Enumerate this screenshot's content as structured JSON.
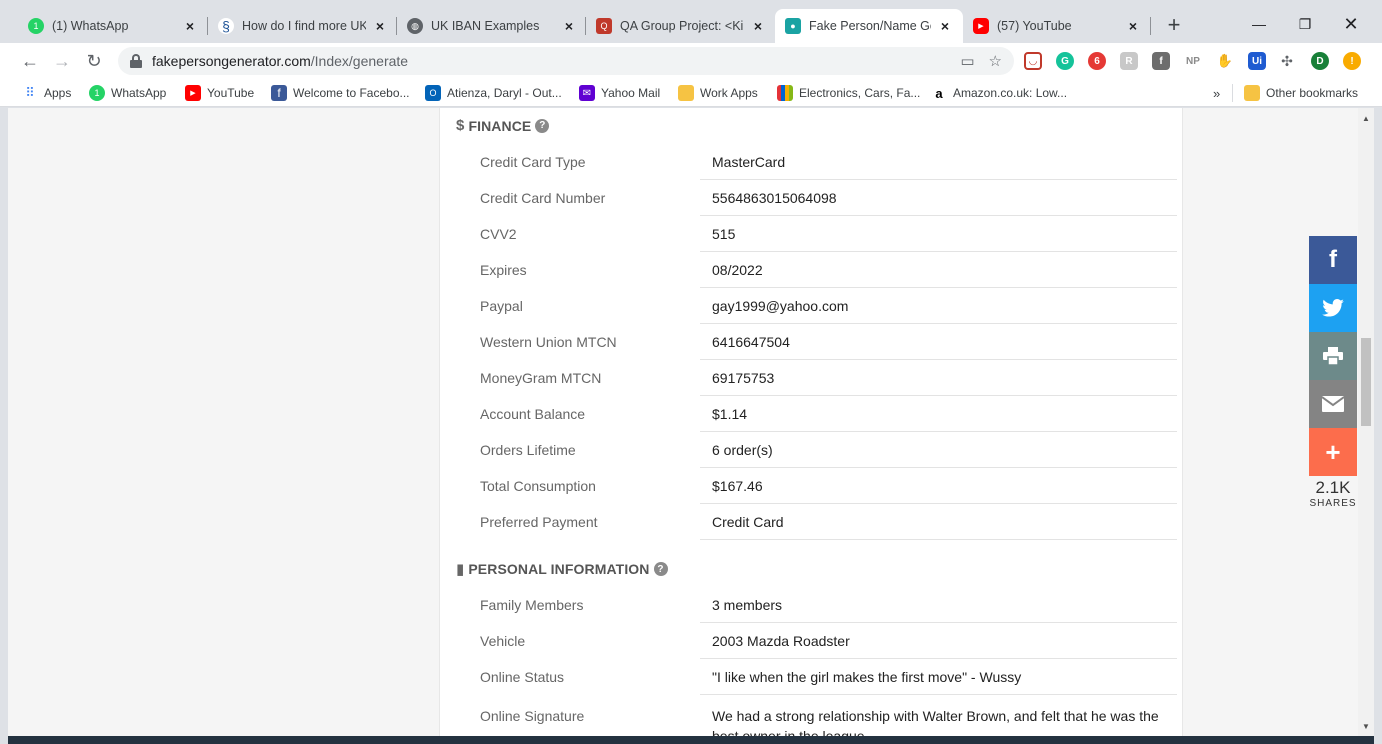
{
  "tabs": [
    {
      "title": "(1) WhatsApp",
      "icon": "whatsapp-icon",
      "color": "#25d366",
      "badge": "1"
    },
    {
      "title": "How do I find more UK",
      "icon": "stackexchange-icon",
      "color": "#1e5397",
      "badge": ""
    },
    {
      "title": "UK IBAN Examples",
      "icon": "globe-icon",
      "color": "#5f6368",
      "badge": ""
    },
    {
      "title": "QA Group Project: <Kin",
      "icon": "qa-icon",
      "color": "#c0392b",
      "badge": ""
    },
    {
      "title": "Fake Person/Name Gen",
      "icon": "person-icon",
      "color": "#1aa3a3",
      "badge": ""
    },
    {
      "title": "(57) YouTube",
      "icon": "youtube-icon",
      "color": "#ff0000",
      "badge": ""
    }
  ],
  "address_bar": {
    "host": "fakepersongenerator.com",
    "path": "/Index/generate"
  },
  "bookmarks": [
    {
      "label": "Apps",
      "icon": "apps-grid-icon"
    },
    {
      "label": "WhatsApp",
      "icon": "whatsapp-icon"
    },
    {
      "label": "YouTube",
      "icon": "youtube-icon"
    },
    {
      "label": "Welcome to Facebo...",
      "icon": "facebook-icon"
    },
    {
      "label": "Atienza, Daryl - Out...",
      "icon": "outlook-icon"
    },
    {
      "label": "Yahoo Mail",
      "icon": "yahoo-mail-icon"
    },
    {
      "label": "Work Apps",
      "icon": "folder-icon"
    },
    {
      "label": "Electronics, Cars, Fa...",
      "icon": "ebay-icon"
    },
    {
      "label": "Amazon.co.uk: Low...",
      "icon": "amazon-icon"
    }
  ],
  "bookmarks_overflow": "»",
  "other_bookmarks": "Other bookmarks",
  "extensions": {
    "ext_badge": "6",
    "np": "NP",
    "ui": "Ui",
    "profile": "D"
  },
  "finance": {
    "heading": "FINANCE",
    "rows": [
      {
        "label": "Credit Card Type",
        "value": "MasterCard"
      },
      {
        "label": "Credit Card Number",
        "value": "5564863015064098"
      },
      {
        "label": "CVV2",
        "value": "515"
      },
      {
        "label": "Expires",
        "value": "08/2022"
      },
      {
        "label": "Paypal",
        "value": "gay1999@yahoo.com"
      },
      {
        "label": "Western Union MTCN",
        "value": "6416647504"
      },
      {
        "label": "MoneyGram MTCN",
        "value": "69175753"
      },
      {
        "label": "Account Balance",
        "value": "$1.14"
      },
      {
        "label": "Orders Lifetime",
        "value": "6 order(s)"
      },
      {
        "label": "Total Consumption",
        "value": "$167.46"
      },
      {
        "label": "Preferred Payment",
        "value": "Credit Card"
      }
    ]
  },
  "personal": {
    "heading": "PERSONAL INFORMATION",
    "rows": [
      {
        "label": "Family Members",
        "value": "3 members"
      },
      {
        "label": "Vehicle",
        "value": "2003 Mazda Roadster"
      },
      {
        "label": "Online Status",
        "value": "\"I like when the girl makes the first move\" - Wussy"
      },
      {
        "label": "Online Signature",
        "value": "We had a strong relationship with Walter Brown, and felt that he was the best owner in the league."
      }
    ]
  },
  "share": {
    "count": "2.1K",
    "label": "SHARES",
    "buttons": [
      {
        "name": "facebook",
        "color": "#3b5998"
      },
      {
        "name": "twitter",
        "color": "#1da1f2"
      },
      {
        "name": "print",
        "color": "#6d8a8a"
      },
      {
        "name": "email",
        "color": "#848484"
      },
      {
        "name": "more",
        "color": "#fc6d4c"
      }
    ]
  }
}
